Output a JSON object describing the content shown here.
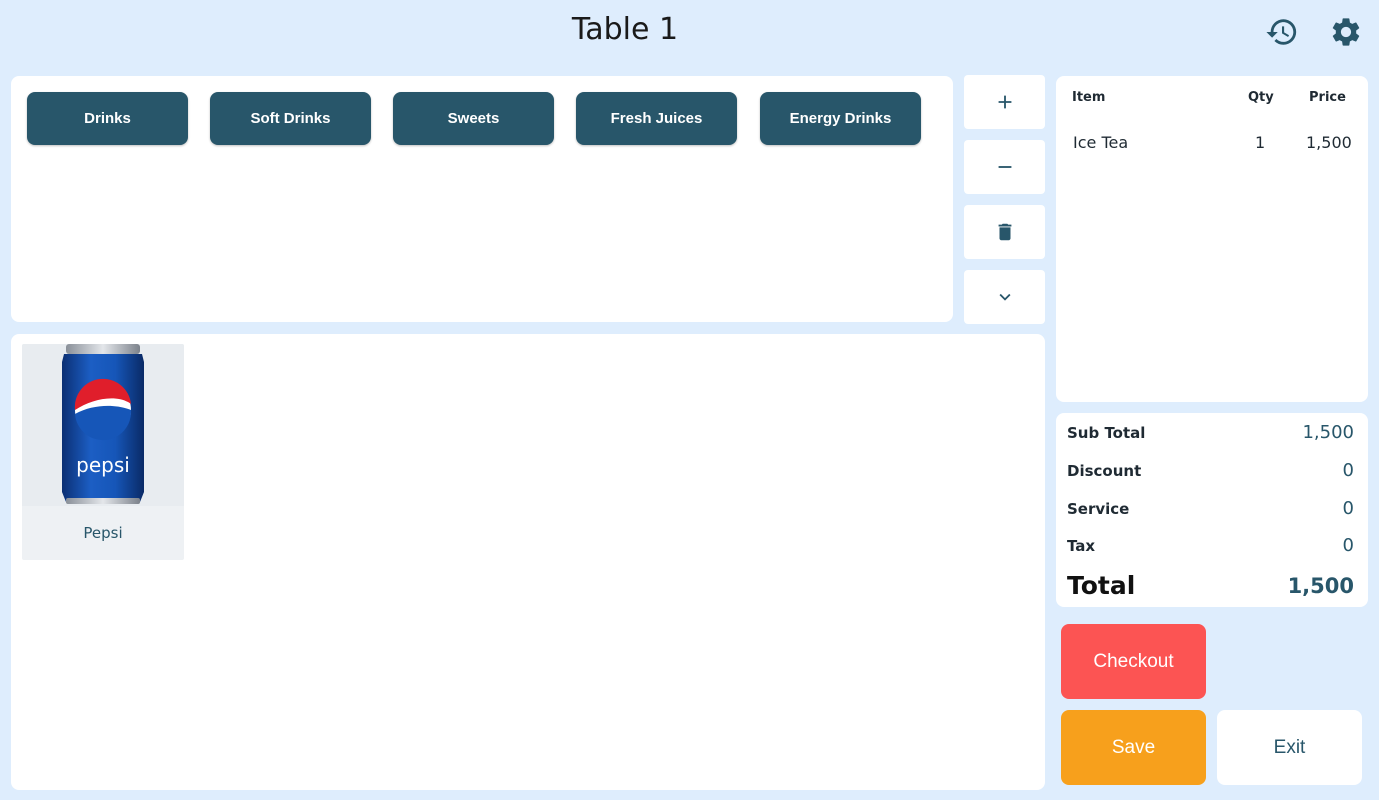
{
  "header": {
    "title": "Table 1"
  },
  "categories": [
    {
      "label": "Drinks"
    },
    {
      "label": "Soft Drinks"
    },
    {
      "label": "Sweets"
    },
    {
      "label": "Fresh Juices"
    },
    {
      "label": "Energy Drinks"
    }
  ],
  "side_actions": [
    "plus-icon",
    "minus-icon",
    "trash-icon",
    "chevron-down-icon"
  ],
  "products": [
    {
      "name": "Pepsi",
      "image_logo_text": "pepsi"
    }
  ],
  "order": {
    "columns": {
      "item": "Item",
      "qty": "Qty",
      "price": "Price"
    },
    "rows": [
      {
        "item": "Ice Tea",
        "qty": "1",
        "price": "1,500"
      }
    ]
  },
  "summary": {
    "subtotal_label": "Sub Total",
    "subtotal": "1,500",
    "discount_label": "Discount",
    "discount": "0",
    "service_label": "Service",
    "service": "0",
    "tax_label": "Tax",
    "tax": "0",
    "total_label": "Total",
    "total": "1,500"
  },
  "actions": {
    "checkout_label": "Checkout",
    "save_label": "Save",
    "exit_label": "Exit"
  },
  "colors": {
    "background": "#deedfd",
    "primary": "#28566a",
    "checkout": "#fc5453",
    "save": "#f7a01c"
  }
}
